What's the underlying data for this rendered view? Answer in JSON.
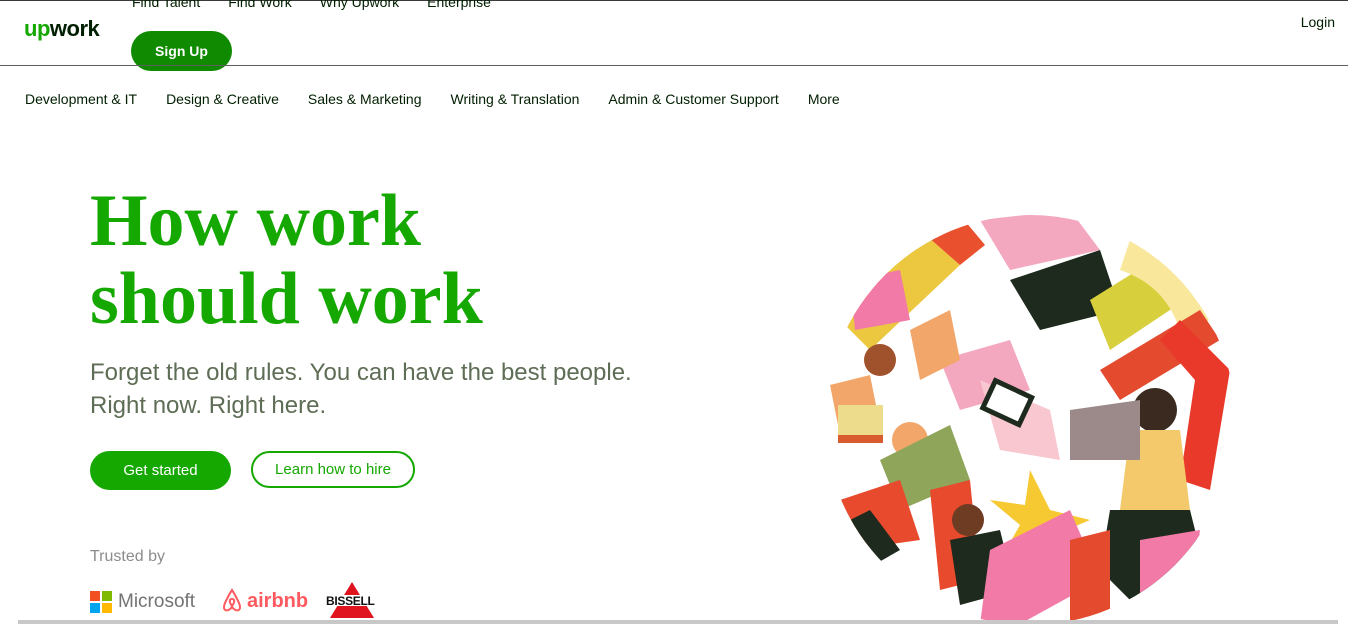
{
  "header": {
    "logo": {
      "up": "up",
      "work": "work"
    },
    "topnav": [
      "Find Talent",
      "Find Work",
      "Why Upwork",
      "Enterprise"
    ],
    "signup_label": "Sign Up",
    "login_label": "Login"
  },
  "categories": [
    "Development & IT",
    "Design & Creative",
    "Sales & Marketing",
    "Writing & Translation",
    "Admin & Customer Support",
    "More"
  ],
  "hero": {
    "title_line1": "How work",
    "title_line2": "should work",
    "subtitle_line1": "Forget the old rules. You can have the best people.",
    "subtitle_line2": "Right now. Right here.",
    "primary_cta": "Get started",
    "secondary_cta": "Learn how to hire"
  },
  "trusted": {
    "label": "Trusted by",
    "logos": [
      "Microsoft",
      "airbnb",
      "BISSELL"
    ]
  },
  "colors": {
    "brand_green": "#14a800",
    "signup_green": "#108a00",
    "airbnb_red": "#ff5a5f",
    "text_dark": "#001e00"
  },
  "icons": [
    "microsoft-logo-icon",
    "airbnb-logo-icon",
    "bissell-logo-icon",
    "people-illustration"
  ]
}
